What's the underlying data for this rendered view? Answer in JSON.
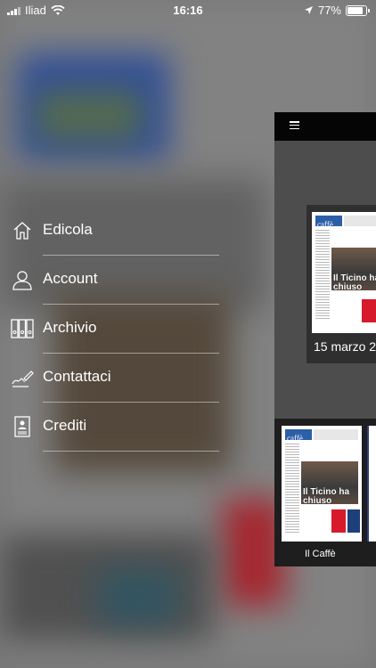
{
  "status_bar": {
    "carrier": "Iliad",
    "time": "16:16",
    "battery": "77%",
    "battery_level": 0.77
  },
  "menu": {
    "items": [
      {
        "label": "Edicola",
        "icon": "home-icon"
      },
      {
        "label": "Account",
        "icon": "user-icon"
      },
      {
        "label": "Archivio",
        "icon": "archive-icon"
      },
      {
        "label": "Contattaci",
        "icon": "signature-icon"
      },
      {
        "label": "Crediti",
        "icon": "id-card-icon"
      }
    ]
  },
  "preview": {
    "featured_date": "15 marzo 2",
    "featured_headline": "Il Ticino ha chiuso",
    "shelf_item_name": "Il Caffè",
    "shelf_headline": "Il Ticino ha chiuso",
    "masthead": "caffè"
  },
  "colors": {
    "text": "#ffffff",
    "panel_bg": "#4d4d4d",
    "topbar_bg": "#050505",
    "accent_blue": "#2d5fa8",
    "accent_red": "#d6192b"
  }
}
